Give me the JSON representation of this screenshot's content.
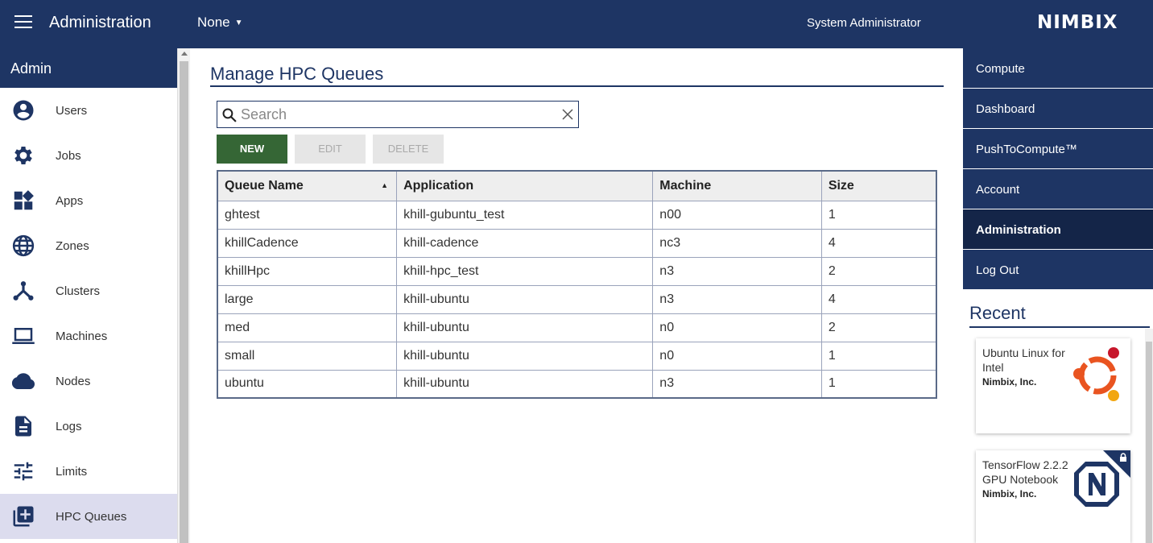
{
  "header": {
    "app_title": "Administration",
    "team_selector": "None",
    "user_name": "System Administrator",
    "logo_text": "NIMBIX",
    "color": "#1e3564"
  },
  "sidebar": {
    "title": "Admin",
    "items": [
      {
        "label": "Users",
        "icon": "account-circle-icon"
      },
      {
        "label": "Jobs",
        "icon": "gear-icon"
      },
      {
        "label": "Apps",
        "icon": "widgets-icon"
      },
      {
        "label": "Zones",
        "icon": "globe-icon"
      },
      {
        "label": "Clusters",
        "icon": "cluster-icon"
      },
      {
        "label": "Machines",
        "icon": "laptop-icon"
      },
      {
        "label": "Nodes",
        "icon": "cloud-icon"
      },
      {
        "label": "Logs",
        "icon": "document-icon"
      },
      {
        "label": "Limits",
        "icon": "sliders-icon"
      },
      {
        "label": "HPC Queues",
        "icon": "add-queue-icon",
        "active": true
      }
    ]
  },
  "main": {
    "title": "Manage HPC Queues",
    "search_placeholder": "Search",
    "search_value": "",
    "buttons": {
      "new": "NEW",
      "edit": "EDIT",
      "delete": "DELETE"
    },
    "table": {
      "columns": [
        "Queue Name",
        "Application",
        "Machine",
        "Size"
      ],
      "sorted_column": "Queue Name",
      "sort_direction": "ascending",
      "rows": [
        [
          "ghtest",
          "khill-gubuntu_test",
          "n00",
          "1"
        ],
        [
          "khillCadence",
          "khill-cadence",
          "nc3",
          "4"
        ],
        [
          "khillHpc",
          "khill-hpc_test",
          "n3",
          "2"
        ],
        [
          "large",
          "khill-ubuntu",
          "n3",
          "4"
        ],
        [
          "med",
          "khill-ubuntu",
          "n0",
          "2"
        ],
        [
          "small",
          "khill-ubuntu",
          "n0",
          "1"
        ],
        [
          "ubuntu",
          "khill-ubuntu",
          "n3",
          "1"
        ]
      ]
    }
  },
  "rightnav": {
    "items": [
      {
        "label": "Compute"
      },
      {
        "label": "Dashboard"
      },
      {
        "label": "PushToCompute™"
      },
      {
        "label": "Account"
      },
      {
        "label": "Administration",
        "active": true
      },
      {
        "label": "Log Out"
      }
    ],
    "recent_title": "Recent",
    "recent": [
      {
        "title": "Ubuntu Linux for Intel",
        "vendor": "Nimbix, Inc.",
        "icon": "ubuntu-logo-icon"
      },
      {
        "title": "TensorFlow 2.2.2 GPU Notebook",
        "vendor": "Nimbix, Inc.",
        "icon": "nimbix-n-logo-icon",
        "locked": true
      }
    ]
  }
}
